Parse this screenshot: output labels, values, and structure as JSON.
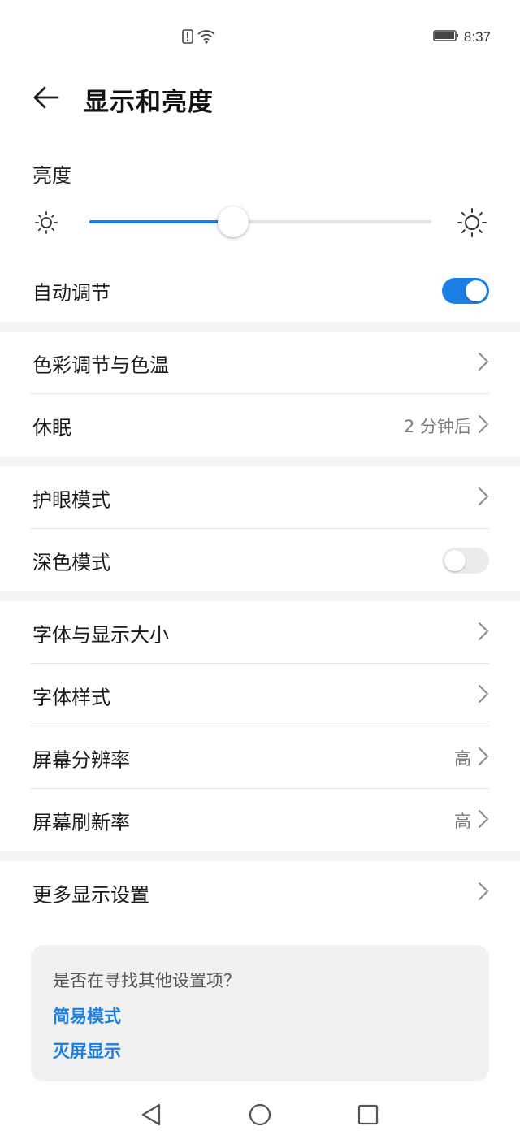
{
  "status_bar": {
    "time": "8:37",
    "icons": [
      "alert-icon",
      "wifi-icon",
      "battery-icon"
    ]
  },
  "header": {
    "title": "显示和亮度",
    "back_icon": "arrow-left-icon"
  },
  "brightness": {
    "label": "亮度",
    "level": 0.42,
    "low_icon": "sun-small-icon",
    "high_icon": "sun-large-icon"
  },
  "auto_adjust": {
    "label": "自动调节",
    "enabled": true
  },
  "rows": {
    "color_temp": {
      "label": "色彩调节与色温"
    },
    "sleep": {
      "label": "休眠",
      "value": "2 分钟后"
    },
    "eye_comfort": {
      "label": "护眼模式"
    },
    "dark_mode": {
      "label": "深色模式",
      "enabled": false
    },
    "font_size": {
      "label": "字体与显示大小"
    },
    "font_style": {
      "label": "字体样式"
    },
    "resolution": {
      "label": "屏幕分辨率",
      "value": "高"
    },
    "refresh_rate": {
      "label": "屏幕刷新率",
      "value": "高"
    },
    "more_display": {
      "label": "更多显示设置"
    }
  },
  "suggestions": {
    "question": "是否在寻找其他设置项？",
    "links": [
      "简易模式",
      "灭屏显示"
    ]
  },
  "nav_bar": {
    "icons": [
      "back-triangle-icon",
      "home-circle-icon",
      "recents-square-icon"
    ]
  },
  "colors": {
    "accent": "#1a7ee5",
    "divider": "#e6e6e6",
    "section_gap": "#f3f3f3",
    "card_bg": "#f1f1f1"
  }
}
